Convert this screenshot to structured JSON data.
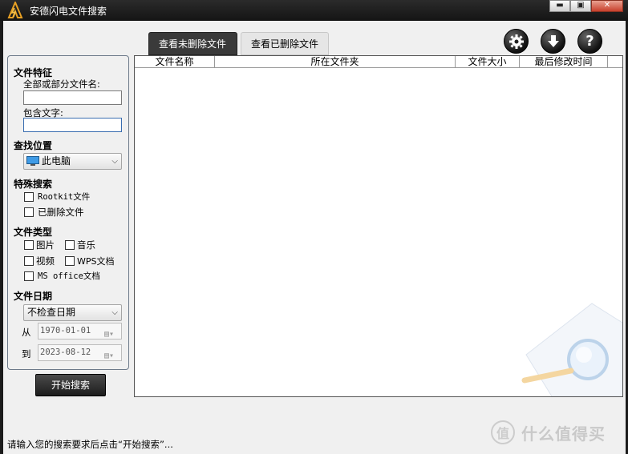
{
  "window": {
    "title": "安德闪电文件搜索",
    "controls": {
      "minimize": "▬",
      "maximize": "▣",
      "close": "✕"
    }
  },
  "tabs": [
    {
      "label": "查看未删除文件",
      "active": true
    },
    {
      "label": "查看已删除文件",
      "active": false
    }
  ],
  "toolbar": {
    "settings_icon": "gear-icon",
    "download_icon": "download-arrow-icon",
    "help_icon": "help-question-icon",
    "help_glyph": "?"
  },
  "sidebar": {
    "features_title": "文件特征",
    "filename_label": "全部或部分文件名:",
    "filename_value": "",
    "contains_label": "包含文字:",
    "contains_value": "",
    "location_title": "查找位置",
    "location_value": "此电脑",
    "special_title": "特殊搜索",
    "special_options": [
      {
        "label": "Rootkit文件",
        "checked": false
      },
      {
        "label": "已删除文件",
        "checked": false
      }
    ],
    "type_title": "文件类型",
    "type_options": [
      {
        "label": "图片",
        "checked": false
      },
      {
        "label": "音乐",
        "checked": false
      },
      {
        "label": "视频",
        "checked": false
      },
      {
        "label": "WPS文档",
        "checked": false
      },
      {
        "label": "MS office文档",
        "checked": false
      }
    ],
    "date_title": "文件日期",
    "date_mode": "不检查日期",
    "from_label": "从",
    "from_value": "1970-01-01",
    "to_label": "到",
    "to_value": "2023-08-12"
  },
  "start_button": "开始搜索",
  "results": {
    "columns": [
      "文件名称",
      "所在文件夹",
      "文件大小",
      "最后修改时间"
    ],
    "rows": []
  },
  "status_text": "请输入您的搜索要求后点击“开始搜索”...",
  "watermark": {
    "brand_glyph": "值",
    "brand_text": "什么值得买"
  },
  "colors": {
    "titlebar": "#1f1f1f",
    "accent_blue": "#3a6db0",
    "active_tab": "#3a3a3a"
  }
}
